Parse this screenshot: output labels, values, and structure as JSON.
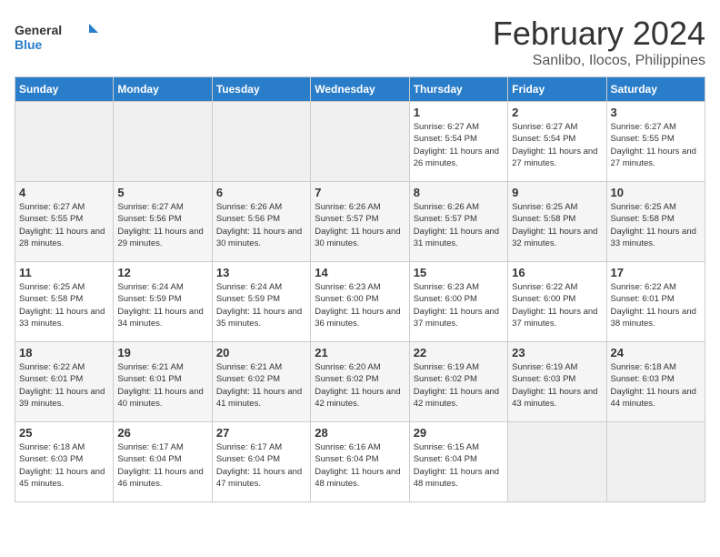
{
  "logo": {
    "line1": "General",
    "line2": "Blue"
  },
  "title": "February 2024",
  "subtitle": "Sanlibo, Ilocos, Philippines",
  "weekdays": [
    "Sunday",
    "Monday",
    "Tuesday",
    "Wednesday",
    "Thursday",
    "Friday",
    "Saturday"
  ],
  "weeks": [
    [
      {
        "day": "",
        "info": ""
      },
      {
        "day": "",
        "info": ""
      },
      {
        "day": "",
        "info": ""
      },
      {
        "day": "",
        "info": ""
      },
      {
        "day": "1",
        "info": "Sunrise: 6:27 AM\nSunset: 5:54 PM\nDaylight: 11 hours and 26 minutes."
      },
      {
        "day": "2",
        "info": "Sunrise: 6:27 AM\nSunset: 5:54 PM\nDaylight: 11 hours and 27 minutes."
      },
      {
        "day": "3",
        "info": "Sunrise: 6:27 AM\nSunset: 5:55 PM\nDaylight: 11 hours and 27 minutes."
      }
    ],
    [
      {
        "day": "4",
        "info": "Sunrise: 6:27 AM\nSunset: 5:55 PM\nDaylight: 11 hours and 28 minutes."
      },
      {
        "day": "5",
        "info": "Sunrise: 6:27 AM\nSunset: 5:56 PM\nDaylight: 11 hours and 29 minutes."
      },
      {
        "day": "6",
        "info": "Sunrise: 6:26 AM\nSunset: 5:56 PM\nDaylight: 11 hours and 30 minutes."
      },
      {
        "day": "7",
        "info": "Sunrise: 6:26 AM\nSunset: 5:57 PM\nDaylight: 11 hours and 30 minutes."
      },
      {
        "day": "8",
        "info": "Sunrise: 6:26 AM\nSunset: 5:57 PM\nDaylight: 11 hours and 31 minutes."
      },
      {
        "day": "9",
        "info": "Sunrise: 6:25 AM\nSunset: 5:58 PM\nDaylight: 11 hours and 32 minutes."
      },
      {
        "day": "10",
        "info": "Sunrise: 6:25 AM\nSunset: 5:58 PM\nDaylight: 11 hours and 33 minutes."
      }
    ],
    [
      {
        "day": "11",
        "info": "Sunrise: 6:25 AM\nSunset: 5:58 PM\nDaylight: 11 hours and 33 minutes."
      },
      {
        "day": "12",
        "info": "Sunrise: 6:24 AM\nSunset: 5:59 PM\nDaylight: 11 hours and 34 minutes."
      },
      {
        "day": "13",
        "info": "Sunrise: 6:24 AM\nSunset: 5:59 PM\nDaylight: 11 hours and 35 minutes."
      },
      {
        "day": "14",
        "info": "Sunrise: 6:23 AM\nSunset: 6:00 PM\nDaylight: 11 hours and 36 minutes."
      },
      {
        "day": "15",
        "info": "Sunrise: 6:23 AM\nSunset: 6:00 PM\nDaylight: 11 hours and 37 minutes."
      },
      {
        "day": "16",
        "info": "Sunrise: 6:22 AM\nSunset: 6:00 PM\nDaylight: 11 hours and 37 minutes."
      },
      {
        "day": "17",
        "info": "Sunrise: 6:22 AM\nSunset: 6:01 PM\nDaylight: 11 hours and 38 minutes."
      }
    ],
    [
      {
        "day": "18",
        "info": "Sunrise: 6:22 AM\nSunset: 6:01 PM\nDaylight: 11 hours and 39 minutes."
      },
      {
        "day": "19",
        "info": "Sunrise: 6:21 AM\nSunset: 6:01 PM\nDaylight: 11 hours and 40 minutes."
      },
      {
        "day": "20",
        "info": "Sunrise: 6:21 AM\nSunset: 6:02 PM\nDaylight: 11 hours and 41 minutes."
      },
      {
        "day": "21",
        "info": "Sunrise: 6:20 AM\nSunset: 6:02 PM\nDaylight: 11 hours and 42 minutes."
      },
      {
        "day": "22",
        "info": "Sunrise: 6:19 AM\nSunset: 6:02 PM\nDaylight: 11 hours and 42 minutes."
      },
      {
        "day": "23",
        "info": "Sunrise: 6:19 AM\nSunset: 6:03 PM\nDaylight: 11 hours and 43 minutes."
      },
      {
        "day": "24",
        "info": "Sunrise: 6:18 AM\nSunset: 6:03 PM\nDaylight: 11 hours and 44 minutes."
      }
    ],
    [
      {
        "day": "25",
        "info": "Sunrise: 6:18 AM\nSunset: 6:03 PM\nDaylight: 11 hours and 45 minutes."
      },
      {
        "day": "26",
        "info": "Sunrise: 6:17 AM\nSunset: 6:04 PM\nDaylight: 11 hours and 46 minutes."
      },
      {
        "day": "27",
        "info": "Sunrise: 6:17 AM\nSunset: 6:04 PM\nDaylight: 11 hours and 47 minutes."
      },
      {
        "day": "28",
        "info": "Sunrise: 6:16 AM\nSunset: 6:04 PM\nDaylight: 11 hours and 48 minutes."
      },
      {
        "day": "29",
        "info": "Sunrise: 6:15 AM\nSunset: 6:04 PM\nDaylight: 11 hours and 48 minutes."
      },
      {
        "day": "",
        "info": ""
      },
      {
        "day": "",
        "info": ""
      }
    ]
  ]
}
